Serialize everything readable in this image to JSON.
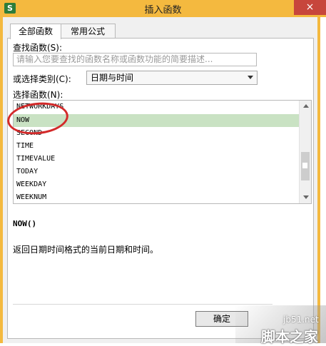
{
  "window": {
    "title": "插入函数",
    "app_icon": "S",
    "close_label": "×"
  },
  "tabs": [
    {
      "label": "全部函数",
      "active": true
    },
    {
      "label": "常用公式",
      "active": false
    }
  ],
  "search": {
    "label": "查找函数(S):",
    "placeholder": "请输入您要查找的函数名称或函数功能的简要描述..."
  },
  "category": {
    "label": "或选择类别(C):",
    "value": "日期与时间"
  },
  "function_list": {
    "label": "选择函数(N):",
    "items": [
      "NETWORKDAYS",
      "NOW",
      "SECOND",
      "TIME",
      "TIMEVALUE",
      "TODAY",
      "WEEKDAY",
      "WEEKNUM"
    ],
    "selected_index": 1
  },
  "details": {
    "signature": "NOW()",
    "description": "返回日期时间格式的当前日期和时间。"
  },
  "buttons": {
    "ok": "确定"
  },
  "watermark": {
    "url": "jb51.net",
    "text": "脚本之家"
  },
  "colors": {
    "title_bar": "#f4b93f",
    "close": "#c7463c",
    "selection": "#c9e2c3",
    "annotation": "#d32a2a"
  }
}
